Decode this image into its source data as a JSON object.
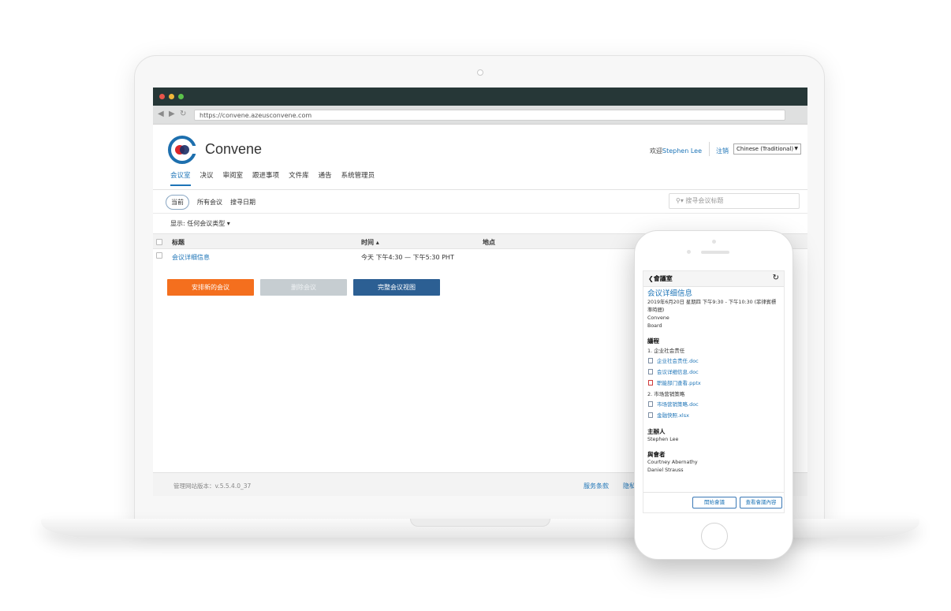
{
  "browser": {
    "url": "https://convene.azeusconvene.com"
  },
  "header": {
    "brand": "Convene",
    "welcome_prefix": "欢迎",
    "user": "Stephen Lee",
    "logout": "注销",
    "language": "Chinese (Traditional)"
  },
  "menu": [
    {
      "label": "会议室",
      "active": true
    },
    {
      "label": "决议"
    },
    {
      "label": "审阅室"
    },
    {
      "label": "跟进事项"
    },
    {
      "label": "文件库"
    },
    {
      "label": "通告"
    },
    {
      "label": "系统管理员"
    }
  ],
  "subtabs": {
    "current": "当前",
    "all": "所有会议",
    "search_date": "搜寻日期"
  },
  "search": {
    "placeholder": "搜寻会议标题"
  },
  "filter": {
    "label": "显示:",
    "value": "任何会议类型"
  },
  "table": {
    "headers": {
      "title": "标题",
      "time": "时间",
      "location": "地点"
    },
    "rows": [
      {
        "title": "会议详细信息",
        "time": "今天 下午4:30 — 下午5:30 PHT",
        "location": ""
      }
    ]
  },
  "buttons": {
    "schedule": "安排新的会议",
    "delete": "删除会议",
    "full_view": "完整会议视图"
  },
  "footer": {
    "version": "管理网站版本：v.5.5.4.0_37",
    "terms": "服务条款",
    "privacy": "隐私"
  },
  "phone": {
    "back": "會議室",
    "title": "会议详细信息",
    "datetime": "2019年6月20日 星期四 下午9:30 - 下午10:30 (菲律賓標準時間)",
    "org": "Convene",
    "type": "Board",
    "agenda_heading": "議程",
    "agenda": [
      {
        "label": "1. 企业社会责任",
        "files": [
          {
            "name": "企业社会责任.doc",
            "kind": "doc"
          },
          {
            "name": "会议详细信息.doc",
            "kind": "doc"
          },
          {
            "name": "职能部门查看.pptx",
            "kind": "pptx"
          }
        ]
      },
      {
        "label": "2. 市场营销策略",
        "files": [
          {
            "name": "市场营销策略.doc",
            "kind": "doc"
          },
          {
            "name": "金融快照.xlsx",
            "kind": "xlsx"
          }
        ]
      }
    ],
    "host_heading": "主辦人",
    "host": "Stephen Lee",
    "attendees_heading": "與會者",
    "attendees": [
      "Courtney Abernathy",
      "Daniel Strauss"
    ],
    "start_button": "開始會議",
    "view_button": "查看會議內容"
  },
  "colors": {
    "accent": "#1d74b7",
    "orange": "#f46f1e",
    "dark_blue": "#2c5f93",
    "titlebar": "#263737"
  }
}
